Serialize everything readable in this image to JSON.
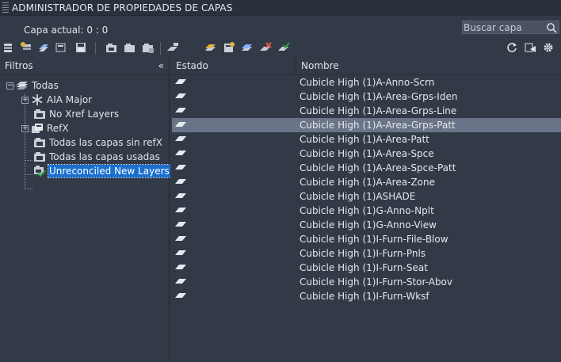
{
  "window": {
    "title": "ADMINISTRADOR DE PROPIEDADES DE CAPAS"
  },
  "current_layer": {
    "label": "Capa actual: 0 : 0"
  },
  "search": {
    "placeholder": "Buscar capa",
    "value": ""
  },
  "colors": {
    "background": "#333a47",
    "selection": "#6a7488",
    "tree_selection": "#1c6fcf",
    "accent_green": "#2ea043",
    "icon_yellow": "#e3b341"
  },
  "filters": {
    "header": "Filtros",
    "collapse_glyph": "«",
    "root": {
      "label": "Todas",
      "expanded_glyph": "−"
    },
    "items": [
      {
        "label": "AIA Major",
        "icon": "snowflake-filter-icon",
        "expander": "+"
      },
      {
        "label": "No Xref Layers",
        "icon": "layer-filter-icon",
        "expander": ""
      },
      {
        "label": "RefX",
        "icon": "xref-filter-icon",
        "expander": "+"
      },
      {
        "label": "Todas las capas sin refX",
        "icon": "layer-filter-icon",
        "expander": ""
      },
      {
        "label": "Todas las capas usadas",
        "icon": "layer-filter-icon",
        "expander": ""
      },
      {
        "label": "Unreconciled New Layers",
        "icon": "unreconciled-filter-icon",
        "expander": "",
        "selected": true
      }
    ]
  },
  "layer_table": {
    "columns": [
      "Estado",
      "Nombre"
    ],
    "selected_index": 3,
    "rows": [
      "Cubicle High (1)A-Anno-Scrn",
      "Cubicle High (1)A-Area-Grps-Iden",
      "Cubicle High (1)A-Area-Grps-Line",
      "Cubicle High (1)A-Area-Grps-Patt",
      "Cubicle High (1)A-Area-Patt",
      "Cubicle High (1)A-Area-Spce",
      "Cubicle High (1)A-Area-Spce-Patt",
      "Cubicle High (1)A-Area-Zone",
      "Cubicle High (1)ASHADE",
      "Cubicle High (1)G-Anno-Nplt",
      "Cubicle High (1)G-Anno-View",
      "Cubicle High (1)I-Furn-File-Blow",
      "Cubicle High (1)I-Furn-Pnls",
      "Cubicle High (1)I-Furn-Seat",
      "Cubicle High (1)I-Furn-Stor-Abov",
      "Cubicle High (1)I-Furn-Wksf"
    ]
  },
  "toolbar": {
    "left_buttons": [
      "new-property-filter-icon",
      "new-group-filter-icon",
      "layer-states-icon",
      "layer-states-manager-icon",
      "save-icon"
    ],
    "mid_buttons": [
      "new-layer-icon",
      "new-layer-vp-frozen-icon",
      "delete-layer-icon"
    ],
    "right_group": [
      "set-current-icon"
    ],
    "action_buttons": [
      "make-current-icon",
      "new-vp-icon",
      "freeze-icon",
      "delete-icon",
      "reconcile-icon"
    ],
    "far_right": [
      "refresh-icon",
      "apply-icon",
      "settings-gear-icon"
    ]
  }
}
